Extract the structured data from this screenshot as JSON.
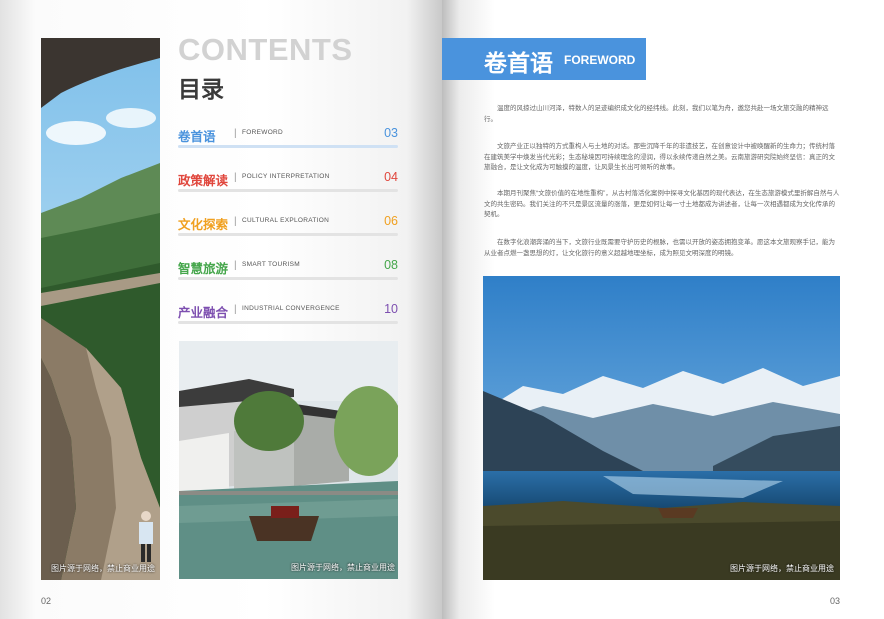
{
  "left_page": {
    "contents_en": "CONTENTS",
    "contents_cn": "目录",
    "toc": [
      {
        "cn": "卷首语",
        "en": "FOREWORD",
        "page": "03",
        "color": "#4a93dd"
      },
      {
        "cn": "政策解读",
        "en": "POLICY INTERPRETATION",
        "page": "04",
        "color": "#e0463c"
      },
      {
        "cn": "文化探索",
        "en": "CULTURAL EXPLORATION",
        "page": "06",
        "color": "#f0a020"
      },
      {
        "cn": "智慧旅游",
        "en": "SMART TOURISM",
        "page": "08",
        "color": "#45a64b"
      },
      {
        "cn": "产业融合",
        "en": "INDUSTRIAL CONVERGENCE",
        "page": "10",
        "color": "#7d4fb0"
      }
    ],
    "toc_separator": "|",
    "photo_caption_1": "图片源于网络，禁止商业用途",
    "photo_caption_2": "图片源于网络，禁止商业用途",
    "page_number": "02"
  },
  "right_page": {
    "title_cn": "卷首语",
    "title_en": "FOREWORD",
    "paragraphs": [
      "温度的风掠过山川河泽，特数人的足迹编织成文化的经纬线。此刻，我们以笔为舟，邀您共赴一场文旅交融的精神远行。",
      "文旅产业正以独特的方式重构人与土地的对话。那些沉降千年的非遗技艺，在创意设计中被唤醒新的生命力；传统村落在建筑美学中焕发当代光彩；生态秘境因可持续理念的浸润，得以永续传递自然之美。云南旅游研究院始终坚信：真正的文旅融合，是让文化成为可触摸的温度，让风景生长出可倾听的故事。",
      "本期月刊聚焦“文旅价值的在地性重构”，从古村落活化案例中探寻文化基因的现代表达，在生态旅游模式里折解自然与人文的共生密码。我们关注的不只是景区流量的涨落，更是如何让每一寸土地都成为讲述者，让每一次相遇都成为文化传承的契机。",
      "在数字化浪潮奔涌的当下，文旅行业既需要守护历史的根脉，也需以开放的姿态拥抱变革。愿这本文旅观察手记，能为从业者点燃一盏思想的灯，让文化旅行的意义超越地理坐标，成为照见文明深度的明镜。"
    ],
    "photo_caption": "图片源于网络，禁止商业用途",
    "page_number": "03"
  }
}
